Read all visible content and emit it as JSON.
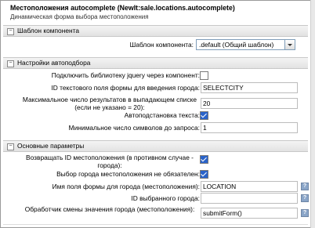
{
  "header": {
    "title": "Местоположения autocomplete (NewIt:sale.locations.autocomplete)",
    "subtitle": "Динамическая форма выбора местоположения"
  },
  "sections": {
    "template": {
      "title": "Шаблон компонента",
      "template_label": "Шаблон компонента:",
      "template_value": ".default (Общий шаблон)"
    },
    "ajax": {
      "title": "Настройки автоподбора",
      "jquery_label": "Подключить библиотеку jquery через компонент:",
      "text_field_id_label": "ID текстового поля формы для введения города:",
      "text_field_id_value": "SELECTCITY",
      "max_results_label": "Максимальное число результатов в выпадающем списке (если не указано = 20):",
      "max_results_value": "20",
      "autocomplete_label": "Автоподстановка текста:",
      "min_chars_label": "Минимальное число символов до запроса:",
      "min_chars_value": "1"
    },
    "base": {
      "title": "Основные параметры",
      "return_id_label": "Возвращать ID местоположения (в противном случае - города):",
      "not_required_label": "Выбор города местоположения не обязателен:",
      "field_name_label": "Имя поля формы для города (местоположения):",
      "field_name_value": "LOCATION",
      "selected_id_label": "ID выбранного города:",
      "selected_id_value": "",
      "handler_label": "Обработчик смены значения города (местоположения):",
      "handler_value": "submitForm()"
    }
  },
  "icons": {
    "help": "?",
    "collapse": "−"
  },
  "colors": {
    "section_bg": "#e8e8e8",
    "checkbox_checked": "#2a63c9",
    "help_icon": "#8aa5c8"
  }
}
